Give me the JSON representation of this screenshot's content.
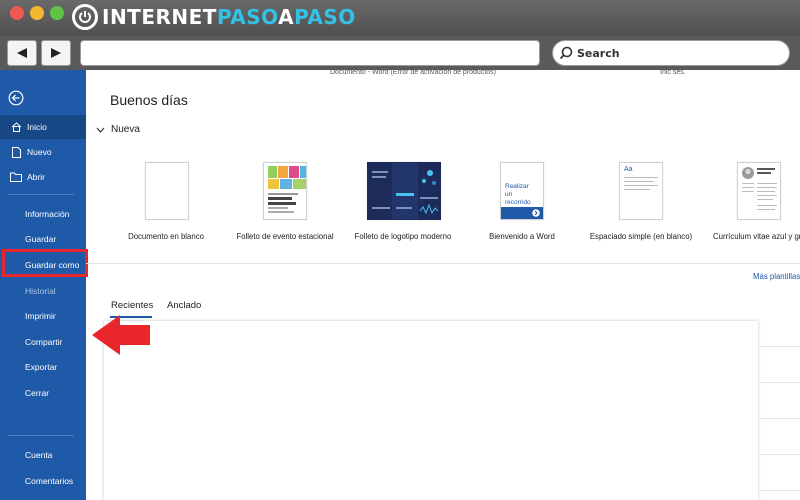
{
  "brand": {
    "name_part1": "INTERNET",
    "name_part2": "PASO",
    "name_part3": "A",
    "name_part4": "PASO"
  },
  "browser": {
    "search_label": "Search",
    "address_value": ""
  },
  "word": {
    "doc_title": "Documento - Word (Error de activación de productos)",
    "user_text": "Inic ses.",
    "greeting": "Buenos días",
    "section_new": "Nueva",
    "more_templates": "Más plantillas",
    "templates": [
      {
        "label": "Documento en blanco"
      },
      {
        "label": "Folleto de evento estacional"
      },
      {
        "label": "Folleto de logotipo moderno"
      },
      {
        "label": "Bienvenido a Word",
        "thumb_text": "Realizar un recorrido"
      },
      {
        "label": "Espaciado simple (en blanco)",
        "thumb_text": "Aa"
      },
      {
        "label": "Currículum vitae azul y gri"
      }
    ],
    "tabs": {
      "recent": "Recientes",
      "pinned": "Anclado"
    },
    "sidebar": {
      "home": "Inicio",
      "new": "Nuevo",
      "open": "Abrir",
      "info": "Información",
      "save": "Guardar",
      "save_as": "Guardar como",
      "history": "Historial",
      "print": "Imprimir",
      "share": "Compartir",
      "export": "Exportar",
      "close": "Cerrar",
      "account": "Cuenta",
      "feedback": "Comentarios"
    }
  },
  "colors": {
    "word_blue": "#1f5aa8",
    "highlight_red": "#e8262b"
  }
}
